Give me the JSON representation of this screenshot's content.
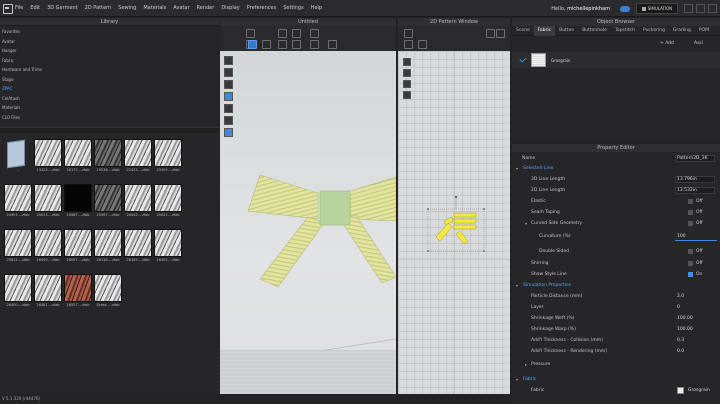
{
  "menu": {
    "items": [
      "File",
      "Edit",
      "3D Garment",
      "2D Pattern",
      "Sewing",
      "Materials",
      "Avatar",
      "Render",
      "Display",
      "Preferences",
      "Settings",
      "Help"
    ],
    "greeting": "Hello, ",
    "username": "michellepinkham",
    "simulation_label": "SIMULATION"
  },
  "library": {
    "title": "Library",
    "nav": [
      "Favorites",
      "Avatar",
      "Hanger",
      "Fabric",
      "Hardware and Trims",
      "Stage",
      "ZPAC",
      "CelAtash",
      "Materials",
      "CLO Files"
    ],
    "active_nav": "ZPAC",
    "thumbs": [
      {
        "caption": "..",
        "style": "folder"
      },
      {
        "caption": "13423....zfab",
        "style": "light"
      },
      {
        "caption": "16172....zfab",
        "style": "light"
      },
      {
        "caption": "19538....zfab",
        "style": "dark"
      },
      {
        "caption": "22433....zfab",
        "style": "light"
      },
      {
        "caption": "23495....zfab",
        "style": "light"
      },
      {
        "caption": "24951....zfab",
        "style": "light"
      },
      {
        "caption": "25013....zfab",
        "style": "light"
      },
      {
        "caption": "25067....zfab",
        "style": "black"
      },
      {
        "caption": "25067....zfab",
        "style": "dark"
      },
      {
        "caption": "26442....zfab",
        "style": "light"
      },
      {
        "caption": "25022....zfab",
        "style": "light"
      },
      {
        "caption": "25811....zfab",
        "style": "light"
      },
      {
        "caption": "26009....zfab",
        "style": "light"
      },
      {
        "caption": "26097....zfab",
        "style": "light"
      },
      {
        "caption": "26118....zfab",
        "style": "light"
      },
      {
        "caption": "26165....zfab",
        "style": "light"
      },
      {
        "caption": "26405....zfab",
        "style": "light"
      },
      {
        "caption": "26400....zfab",
        "style": "light"
      },
      {
        "caption": "26481....zfab",
        "style": "light"
      },
      {
        "caption": "26527....zfab",
        "style": "red"
      },
      {
        "caption": "Gross.....zfab",
        "style": "light"
      }
    ]
  },
  "viewport": {
    "title": "Untitled",
    "version": "V 5.1.330 (r44476)"
  },
  "pattern_window": {
    "title": "2D Pattern Window"
  },
  "object_browser": {
    "title": "Object Browser",
    "tabs": [
      "Scene",
      "Fabric",
      "Button",
      "Buttonhole",
      "Topstitch",
      "Puckering",
      "Grading",
      "POM"
    ],
    "active_tab": "Fabric",
    "add_label": "+ Add",
    "assign_label": "Assi",
    "fabric_name": "Grosgrain"
  },
  "property_editor": {
    "title": "Property Editor",
    "name_label": "Name",
    "name_value": "Pattern2D_3K",
    "sections": {
      "selected_line": "Selected Line",
      "simulation": "Simulation Properties",
      "fabric": "Fabric"
    },
    "rows": {
      "line_3d_length": {
        "label": "3D Line Length",
        "value": "13.796in"
      },
      "line_2d_length": {
        "label": "2D Line Length",
        "value": "13.532in"
      },
      "elastic": {
        "label": "Elastic",
        "value": "Off"
      },
      "seam_taping": {
        "label": "Seam Taping",
        "value": "Off"
      },
      "curved_side": {
        "label": "Curved Side Geometry",
        "value": "Off"
      },
      "curvature": {
        "label": "Curvature (%)",
        "value": "100"
      },
      "double_sided": {
        "label": "Double Sided",
        "value": "Off"
      },
      "shirring": {
        "label": "Shirring",
        "value": "Off"
      },
      "show_style_line": {
        "label": "Show Style Line",
        "value": "On"
      },
      "particle_distance": {
        "label": "Particle Distance (mm)",
        "value": "2.0"
      },
      "layer": {
        "label": "Layer",
        "value": "0"
      },
      "shrinkage_weft": {
        "label": "Shrinkage Weft (%)",
        "value": "100.00"
      },
      "shrinkage_warp": {
        "label": "Shrinkage Warp (%)",
        "value": "100.00"
      },
      "thickness_collision": {
        "label": "Add'l Thickness - Collision (mm)",
        "value": "0.3"
      },
      "thickness_rendering": {
        "label": "Add'l Thickness - Rendering (mm)",
        "value": "0.0"
      },
      "pressure": {
        "label": "Pressure",
        "value": ""
      },
      "fabric": {
        "label": "Fabric",
        "value": "Grosgrain"
      }
    }
  },
  "colors": {
    "accent": "#3f92e8",
    "bow_fabric": "#e3e6a0",
    "bow_knot": "#b9d49c",
    "pattern_highlight": "#f3ea3e"
  }
}
